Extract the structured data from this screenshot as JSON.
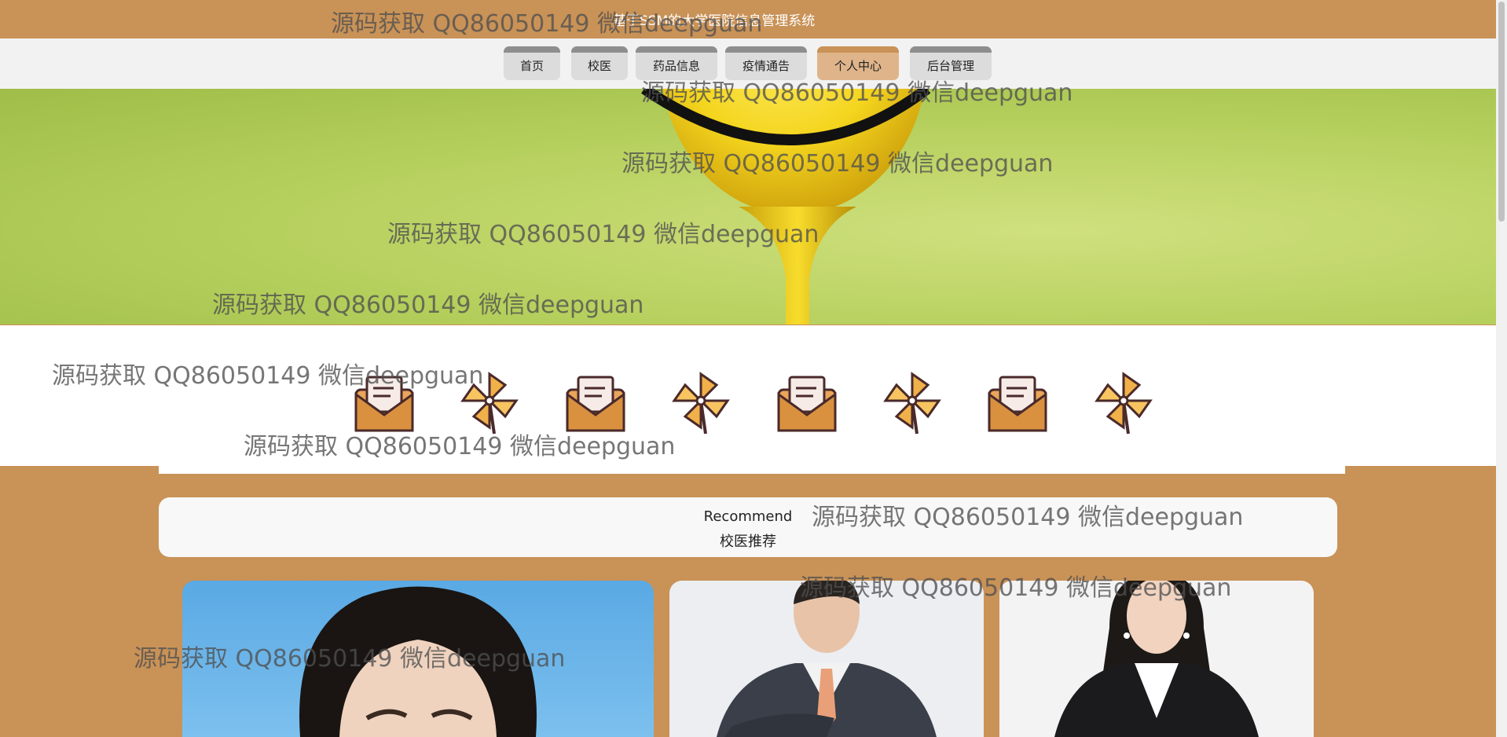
{
  "site": {
    "title": "基于SSM的大学医院信息管理系统"
  },
  "nav": {
    "items": [
      {
        "label": "首页"
      },
      {
        "label": "校医"
      },
      {
        "label": "药品信息"
      },
      {
        "label": "疫情通告"
      },
      {
        "label": "个人中心",
        "active": true
      },
      {
        "label": "后台管理"
      }
    ]
  },
  "icons": [
    "envelope-icon",
    "pinwheel-icon",
    "envelope-icon",
    "pinwheel-icon",
    "envelope-icon",
    "pinwheel-icon",
    "envelope-icon",
    "pinwheel-icon"
  ],
  "recommend": {
    "en": "Recommend",
    "zh": "校医推荐"
  },
  "watermark": {
    "text": "源码获取 QQ86050149 微信deepguan"
  },
  "colors": {
    "brand": "#c99257",
    "nav_bg": "#f2f2f2",
    "active_tab": "#dfb48a"
  }
}
